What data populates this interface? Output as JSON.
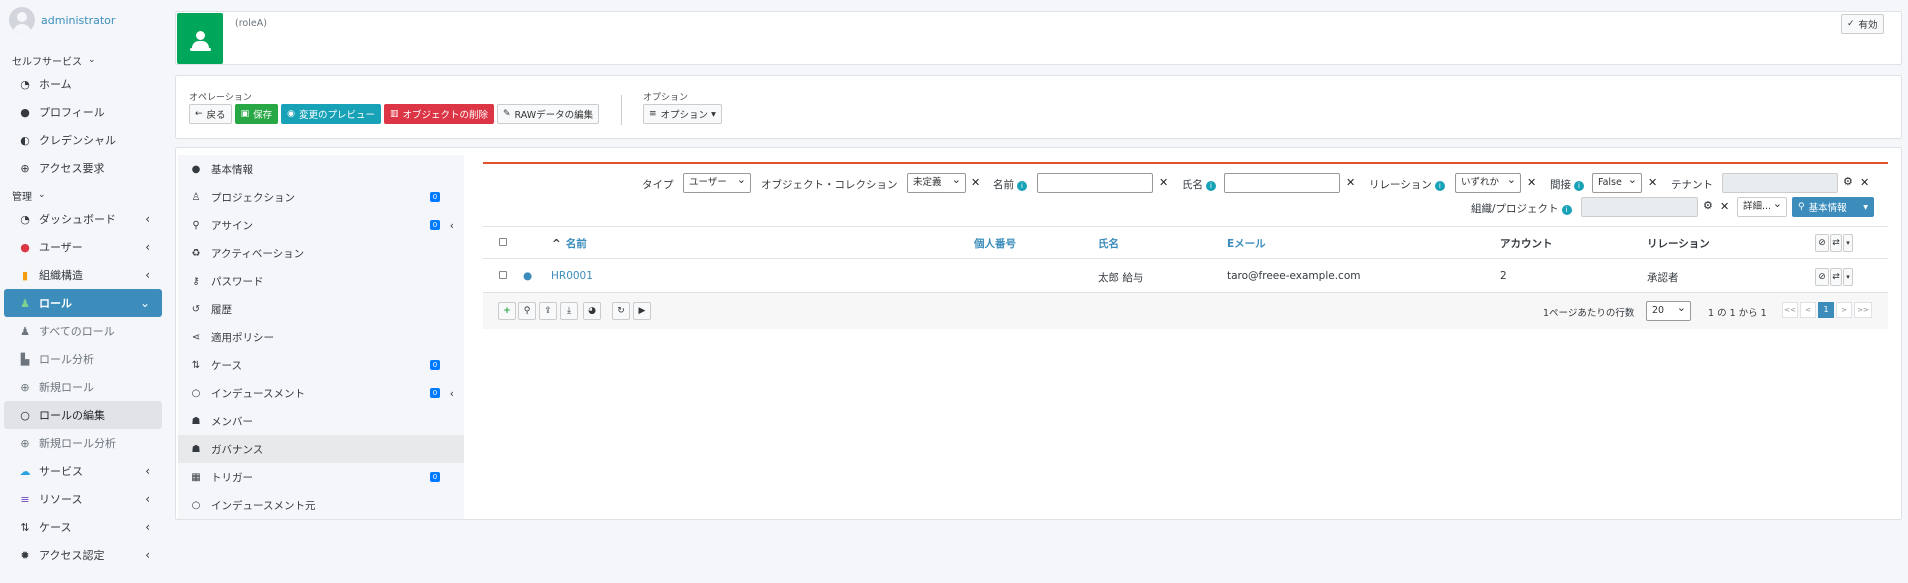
{
  "user": {
    "name": "administrator"
  },
  "sidebar": {
    "sections": [
      {
        "label": "セルフサービス"
      },
      {
        "label": "管理"
      }
    ],
    "self_items": [
      {
        "label": "ホーム",
        "icon": "dashboard-icon"
      },
      {
        "label": "プロフィール",
        "icon": "person-icon"
      },
      {
        "label": "クレデンシャル",
        "icon": "shield-icon"
      },
      {
        "label": "アクセス要求",
        "icon": "plus-circle-icon"
      }
    ],
    "admin_items": [
      {
        "label": "ダッシュボード",
        "icon": "dashboard-icon"
      },
      {
        "label": "ユーザー",
        "icon": "user-icon",
        "color": "#dc3545"
      },
      {
        "label": "組織構造",
        "icon": "org-icon",
        "color": "#f39c12"
      },
      {
        "label": "ロール",
        "icon": "role-icon",
        "active": true
      },
      {
        "label": "すべてのロール",
        "icon": "role-icon",
        "sub": true
      },
      {
        "label": "ロール分析",
        "icon": "chart-icon",
        "sub": true
      },
      {
        "label": "新規ロール",
        "icon": "plus-circle-icon",
        "sub": true
      },
      {
        "label": "ロールの編集",
        "icon": "circle-icon",
        "sub": true,
        "current": true
      },
      {
        "label": "新規ロール分析",
        "icon": "plus-circle-icon",
        "sub": true
      },
      {
        "label": "サービス",
        "icon": "cloud-icon",
        "color": "#29a3e0"
      },
      {
        "label": "リソース",
        "icon": "database-icon",
        "color": "#6f42c1"
      },
      {
        "label": "ケース",
        "icon": "case-icon"
      },
      {
        "label": "アクセス認定",
        "icon": "certification-icon"
      }
    ]
  },
  "header": {
    "subtitle": "(roleA)",
    "status_button": "有効"
  },
  "operations": {
    "label": "オペレーション",
    "back": "戻る",
    "save": "保存",
    "preview": "変更のプレビュー",
    "delete": "オブジェクトの削除",
    "raw": "RAWデータの編集"
  },
  "options": {
    "label": "オプション",
    "button": "オプション"
  },
  "left_menu": [
    {
      "label": "基本情報",
      "icon": "circle-filled-icon"
    },
    {
      "label": "プロジェクション",
      "icon": "person-icon",
      "badge": "0"
    },
    {
      "label": "アサイン",
      "icon": "assign-icon",
      "badge": "0",
      "expand": true
    },
    {
      "label": "アクティベーション",
      "icon": "recycle-icon"
    },
    {
      "label": "パスワード",
      "icon": "key-icon"
    },
    {
      "label": "履歴",
      "icon": "history-icon"
    },
    {
      "label": "適用ポリシー",
      "icon": "share-icon"
    },
    {
      "label": "ケース",
      "icon": "case-icon",
      "badge": "0"
    },
    {
      "label": "インデュースメント",
      "icon": "circle-icon",
      "badge": "0",
      "expand": true
    },
    {
      "label": "メンバー",
      "icon": "users-icon"
    },
    {
      "label": "ガバナンス",
      "icon": "users-icon",
      "selected": true
    },
    {
      "label": "トリガー",
      "icon": "calendar-icon",
      "badge": "0"
    },
    {
      "label": "インデュースメント元",
      "icon": "circle-icon"
    }
  ],
  "filters": {
    "type_label": "タイプ",
    "type_value": "ユーザー",
    "collection_label": "オブジェクト・コレクション",
    "collection_value": "未定義",
    "name_label": "名前",
    "fullname_label": "氏名",
    "relation_label": "リレーション",
    "relation_value": "いずれか",
    "indirect_label": "間接",
    "indirect_value": "False",
    "tenant_label": "テナント",
    "org_label": "組織/プロジェクト",
    "detail_value": "詳細...",
    "basic_button": "基本情報"
  },
  "table": {
    "headers": [
      "名前",
      "個人番号",
      "氏名",
      "Eメール",
      "アカウント",
      "リレーション"
    ],
    "rows": [
      {
        "name": "HR0001",
        "number": "",
        "fullname": "太郎 給与",
        "email": "taro@freee-example.com",
        "account": "2",
        "relation": "承認者"
      }
    ]
  },
  "pagination": {
    "rows_label": "1ページあたりの行数",
    "rows_value": "20",
    "range": "1 の 1 から 1",
    "first": "<<",
    "prev": "<",
    "page": "1",
    "next": ">",
    "last": ">>"
  }
}
